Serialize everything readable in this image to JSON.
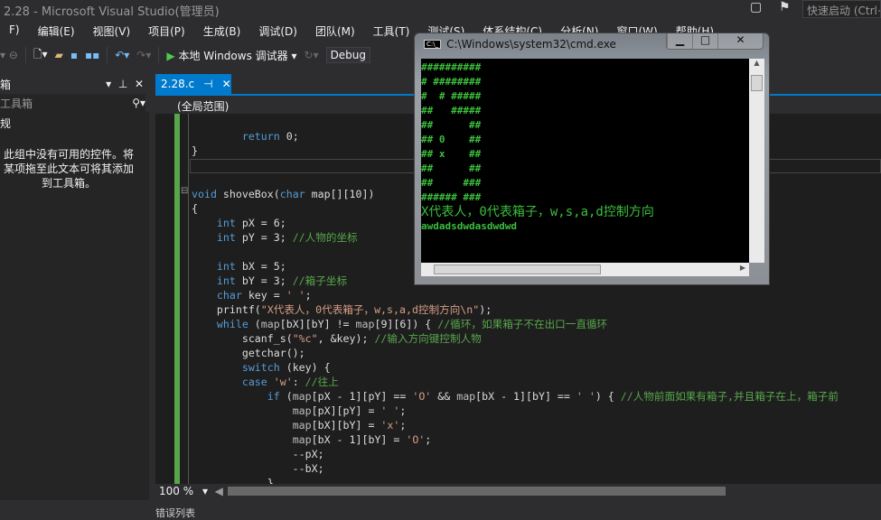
{
  "window": {
    "title": "2.28 - Microsoft Visual Studio(管理员)",
    "quick_launch": "快速启动 (Ctrl+Q)"
  },
  "menu": [
    "F)",
    "编辑(E)",
    "视图(V)",
    "项目(P)",
    "生成(B)",
    "调试(D)",
    "团队(M)",
    "工具(T)",
    "测试(S)",
    "体系结构(C)",
    "分析(N)",
    "窗口(W)",
    "帮助(H)"
  ],
  "toolbar": {
    "run_label": "本地 Windows 调试器",
    "config": "Debug"
  },
  "toolbox": {
    "title": "箱",
    "search_placeholder": "工具箱",
    "group": "规",
    "empty_message": "此组中没有可用的控件。将某项拖至此文本可将其添加到工具箱。"
  },
  "editor": {
    "tab": "2.28.c",
    "scope": "(全局范围)",
    "zoom": "100 %"
  },
  "bottom_panel": "错误列表",
  "code": [
    [
      [
        "tx",
        "        "
      ],
      [
        "kw",
        "return"
      ],
      [
        "tx",
        " 0;"
      ]
    ],
    [
      [
        "tx",
        "}"
      ]
    ],
    [],
    [],
    [
      [
        "kw",
        "void"
      ],
      [
        "tx",
        " shoveBox("
      ],
      [
        "kw",
        "char"
      ],
      [
        "tx",
        " map[][10])"
      ]
    ],
    [
      [
        "tx",
        "{"
      ]
    ],
    [
      [
        "tx",
        "    "
      ],
      [
        "kw",
        "int"
      ],
      [
        "tx",
        " pX = 6;"
      ]
    ],
    [
      [
        "tx",
        "    "
      ],
      [
        "kw",
        "int"
      ],
      [
        "tx",
        " pY = 3; "
      ],
      [
        "cm",
        "//人物的坐标"
      ]
    ],
    [],
    [
      [
        "tx",
        "    "
      ],
      [
        "kw",
        "int"
      ],
      [
        "tx",
        " bX = 5;"
      ]
    ],
    [
      [
        "tx",
        "    "
      ],
      [
        "kw",
        "int"
      ],
      [
        "tx",
        " bY = 3; "
      ],
      [
        "cm",
        "//箱子坐标"
      ]
    ],
    [
      [
        "tx",
        "    "
      ],
      [
        "kw",
        "char"
      ],
      [
        "tx",
        " key = "
      ],
      [
        "st",
        "' '"
      ],
      [
        "tx",
        ";"
      ]
    ],
    [
      [
        "tx",
        "    printf("
      ],
      [
        "st",
        "\"X代表人，0代表箱子，w,s,a,d控制方向\\n\""
      ],
      [
        "tx",
        ");"
      ]
    ],
    [
      [
        "tx",
        "    "
      ],
      [
        "kw",
        "while"
      ],
      [
        "tx",
        " ("
      ],
      [
        "mp",
        "map"
      ],
      [
        "tx",
        "[bX][bY] != "
      ],
      [
        "mp",
        "map"
      ],
      [
        "tx",
        "[9][6]) { "
      ],
      [
        "cm",
        "//循环，如果箱子不在出口一直循环"
      ]
    ],
    [
      [
        "tx",
        "        scanf_s("
      ],
      [
        "st",
        "\"%c\""
      ],
      [
        "tx",
        ", &key); "
      ],
      [
        "cm",
        "//输入方向键控制人物"
      ]
    ],
    [
      [
        "tx",
        "        getchar();"
      ]
    ],
    [
      [
        "tx",
        "        "
      ],
      [
        "kw",
        "switch"
      ],
      [
        "tx",
        " (key) {"
      ]
    ],
    [
      [
        "tx",
        "        "
      ],
      [
        "kw",
        "case"
      ],
      [
        "tx",
        " "
      ],
      [
        "st",
        "'w'"
      ],
      [
        "tx",
        ": "
      ],
      [
        "cm",
        "//往上"
      ]
    ],
    [
      [
        "tx",
        "            "
      ],
      [
        "kw",
        "if"
      ],
      [
        "tx",
        " ("
      ],
      [
        "mp",
        "map"
      ],
      [
        "tx",
        "[pX - 1][pY] == "
      ],
      [
        "st",
        "'O'"
      ],
      [
        "tx",
        " && "
      ],
      [
        "mp",
        "map"
      ],
      [
        "tx",
        "[bX - 1][bY] == "
      ],
      [
        "st",
        "' '"
      ],
      [
        "tx",
        ") { "
      ],
      [
        "cm",
        "//人物前面如果有箱子,并且箱子在上，箱子前"
      ]
    ],
    [
      [
        "tx",
        "                "
      ],
      [
        "mp",
        "map"
      ],
      [
        "tx",
        "[pX][pY] = "
      ],
      [
        "st",
        "' '"
      ],
      [
        "tx",
        ";"
      ]
    ],
    [
      [
        "tx",
        "                "
      ],
      [
        "mp",
        "map"
      ],
      [
        "tx",
        "[bX][bY] = "
      ],
      [
        "st",
        "'x'"
      ],
      [
        "tx",
        ";"
      ]
    ],
    [
      [
        "tx",
        "                "
      ],
      [
        "mp",
        "map"
      ],
      [
        "tx",
        "[bX - 1][bY] = "
      ],
      [
        "st",
        "'O'"
      ],
      [
        "tx",
        ";"
      ]
    ],
    [
      [
        "tx",
        "                --pX;"
      ]
    ],
    [
      [
        "tx",
        "                --bX;"
      ]
    ],
    [
      [
        "tx",
        "            }"
      ]
    ]
  ],
  "console": {
    "title": "C:\\Windows\\system32\\cmd.exe",
    "lines": [
      "##########",
      "# ########",
      "#  # #####",
      "##   #####",
      "##      ##",
      "## 0    ##",
      "## x    ##",
      "##      ##",
      "##     ###",
      "###### ###"
    ],
    "prompt": "X代表人，0代表箱子，w,s,a,d控制方向",
    "input": "awdadsdwdasdwdwd"
  }
}
